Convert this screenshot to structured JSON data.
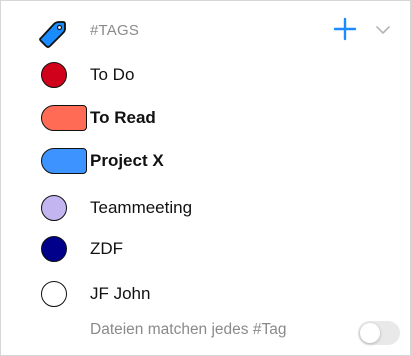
{
  "header": {
    "title": "#TAGS",
    "tag_icon": "tag-icon",
    "add_icon": "plus-icon",
    "collapse_icon": "chevron-down-icon",
    "accent_color": "#1a8cff"
  },
  "tags": [
    {
      "label": "To Do",
      "color": "#d0021b",
      "shape": "circle",
      "bold": false
    },
    {
      "label": "To Read",
      "color": "#ff6b55",
      "shape": "pill",
      "bold": true
    },
    {
      "label": "Project X",
      "color": "#3d93ff",
      "shape": "pill",
      "bold": true
    },
    {
      "label": "Teammeeting",
      "color": "#c3b5f0",
      "shape": "circle",
      "bold": false
    },
    {
      "label": "ZDF",
      "color": "#00008b",
      "shape": "circle",
      "bold": false
    },
    {
      "label": "JF John",
      "color": "#ffffff",
      "shape": "circle",
      "bold": false
    }
  ],
  "footer": {
    "match_all_label": "Dateien matchen jedes #Tag",
    "match_all_enabled": false
  }
}
